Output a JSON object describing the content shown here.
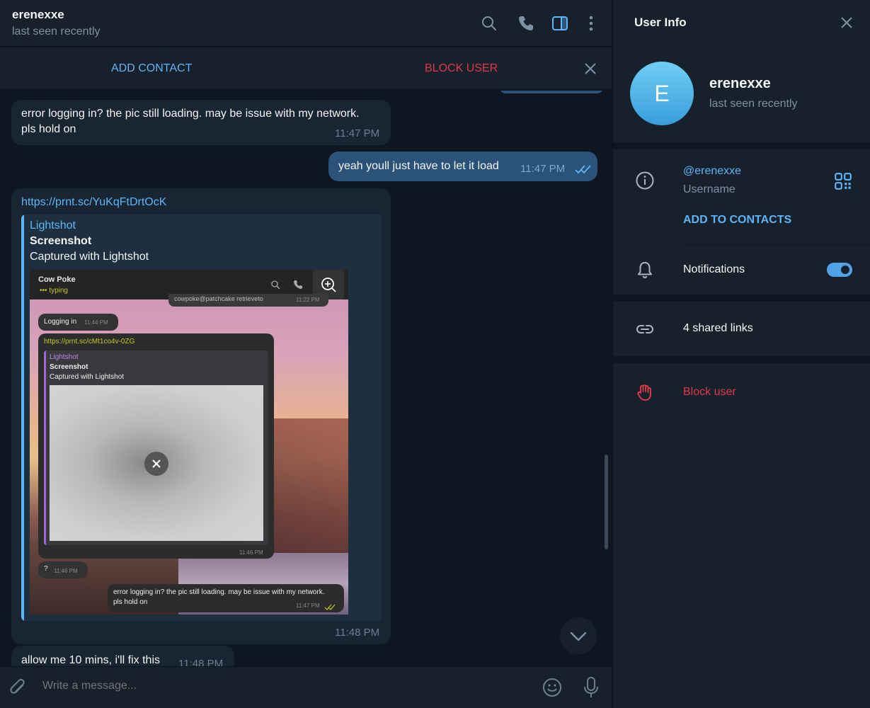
{
  "chat": {
    "title": "erenexxe",
    "status": "last seen recently"
  },
  "action_bar": {
    "add_contact": "ADD CONTACT",
    "block_user": "BLOCK USER"
  },
  "messages": [
    {
      "direction": "in",
      "text": "error logging in? the pic still loading. may be issue with my network.\npls hold on",
      "time": "11:47 PM"
    },
    {
      "direction": "out",
      "text": "yeah youll just have to let it load",
      "time": "11:47 PM",
      "read": true
    },
    {
      "direction": "in",
      "link": "https://prnt.sc/YuKqFtDrtOcK",
      "preview": {
        "site": "Lightshot",
        "title": "Screenshot",
        "description": "Captured with Lightshot"
      },
      "time": "11:48 PM"
    },
    {
      "direction": "in",
      "text": "allow me 10 mins, i'll fix this",
      "time": "11:48 PM"
    }
  ],
  "embedded_screenshot": {
    "contact_name": "Cow Poke",
    "contact_status": "typing",
    "top_text": "cowpoke@patchcake retrieveto",
    "top_time": "11:22 PM",
    "msg1_text": "Logging in",
    "msg1_time": "11:44 PM",
    "link": "https://prnt.sc/cMt1co4v-0ZG",
    "preview_site": "Lightshot",
    "preview_title": "Screenshot",
    "preview_desc": "Captured with Lightshot",
    "preview_time": "11:46 PM",
    "q_text": "?",
    "q_time": "11:46 PM",
    "out_text": "error logging in? the pic still loading. may be issue with my network.\npls hold on",
    "out_time": "11:47 PM"
  },
  "composer": {
    "placeholder": "Write a message..."
  },
  "info_panel": {
    "title": "User Info",
    "avatar_letter": "E",
    "name": "erenexxe",
    "status": "last seen recently",
    "username": "@erenexxe",
    "username_label": "Username",
    "add_to_contacts": "ADD TO CONTACTS",
    "notifications_label": "Notifications",
    "notifications_on": true,
    "shared_links": "4 shared links",
    "block_user": "Block user"
  },
  "colors": {
    "accent": "#5eb5f7",
    "danger": "#e0394a",
    "incoming_bubble": "#182533",
    "outgoing_bubble": "#2b5278",
    "panel": "#17212b",
    "background": "#0e1621"
  },
  "icons": {
    "header": [
      "search-icon",
      "phone-icon",
      "sidebar-toggle-icon",
      "more-vertical-icon"
    ],
    "info": [
      "info-icon",
      "qr-code-icon",
      "bell-icon",
      "link-icon",
      "hand-stop-icon"
    ],
    "composer": [
      "paperclip-icon",
      "emoji-icon",
      "microphone-icon"
    ]
  }
}
